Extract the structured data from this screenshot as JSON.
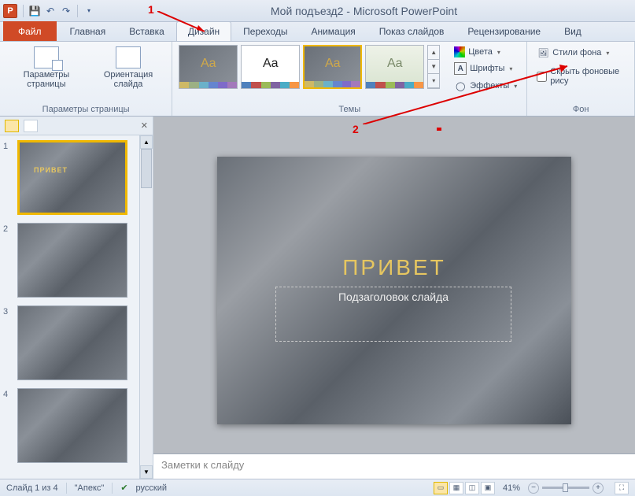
{
  "titlebar": {
    "doc_name": "Мой подъезд2",
    "app_name": "Microsoft PowerPoint"
  },
  "tabs": {
    "file": "Файл",
    "home": "Главная",
    "insert": "Вставка",
    "design": "Дизайн",
    "transitions": "Переходы",
    "animation": "Анимация",
    "slideshow": "Показ слайдов",
    "review": "Рецензирование",
    "view": "Вид"
  },
  "ribbon": {
    "page_setup": {
      "page_params": "Параметры страницы",
      "orientation": "Ориентация слайда",
      "group_label": "Параметры страницы"
    },
    "themes": {
      "group_label": "Темы",
      "colors": "Цвета",
      "fonts": "Шрифты",
      "effects": "Эффекты"
    },
    "background": {
      "styles": "Стили фона",
      "hide": "Скрыть фоновые рису",
      "group_label": "Фон"
    }
  },
  "annotations": {
    "one": "1",
    "two": "2"
  },
  "thumbs": [
    {
      "num": "1",
      "title": "ПРИВЕТ",
      "selected": true
    },
    {
      "num": "2",
      "title": "",
      "selected": false
    },
    {
      "num": "3",
      "title": "",
      "selected": false
    },
    {
      "num": "4",
      "title": "",
      "selected": false
    }
  ],
  "slide": {
    "title": "ПРИВЕТ",
    "subtitle": "Подзаголовок слайда"
  },
  "notes": {
    "placeholder": "Заметки к слайду"
  },
  "statusbar": {
    "slide_info": "Слайд 1 из 4",
    "theme": "\"Апекс\"",
    "language": "русский",
    "zoom": "41%"
  },
  "theme_colors": {
    "office": [
      "#4f81bd",
      "#c0504d",
      "#9bbb59",
      "#8064a2",
      "#4bacc6",
      "#f79646"
    ],
    "apex": [
      "#ceb966",
      "#9cb084",
      "#6bb1c9",
      "#6585cf",
      "#7e6bc9",
      "#a379bb"
    ]
  }
}
